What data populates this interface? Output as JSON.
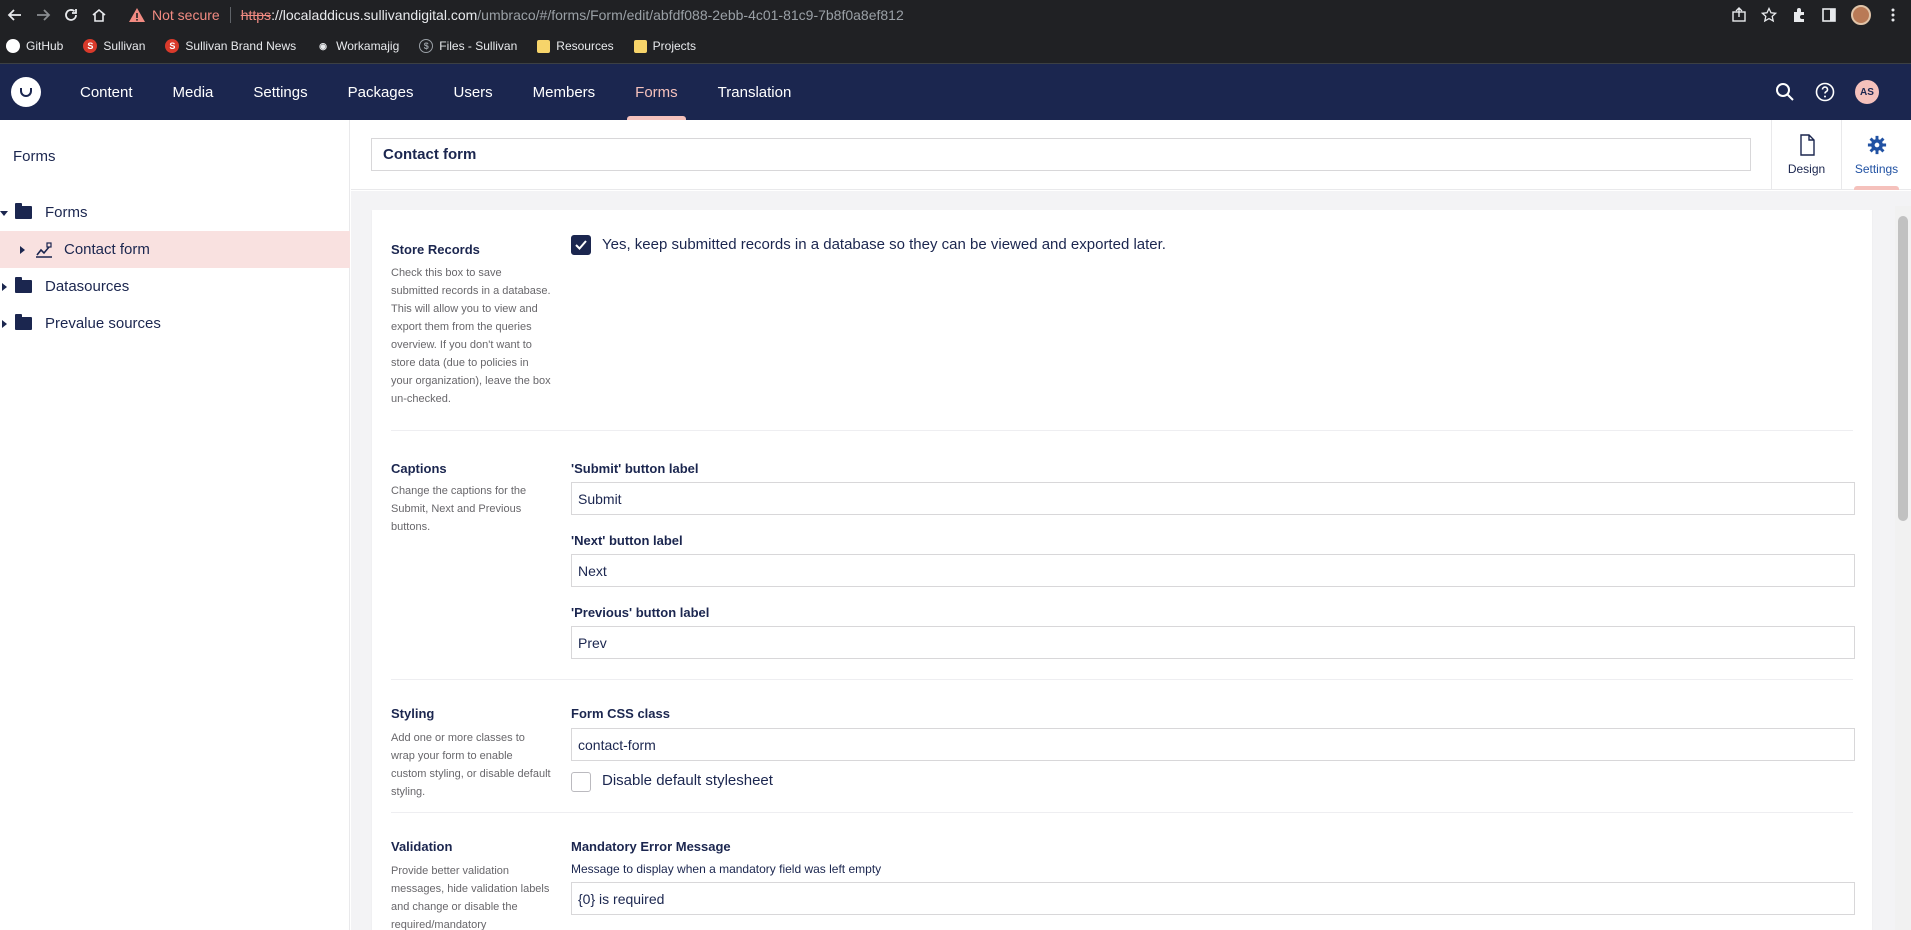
{
  "browser": {
    "security_label": "Not secure",
    "url_scheme": "https",
    "url_sep": "://",
    "url_host": "localaddicus.sullivandigital.com",
    "url_path": "/umbraco/#/forms/Form/edit/abfdf088-2ebb-4c01-81c9-7b8f0a8ef812"
  },
  "bookmarks": [
    {
      "label": "GitHub",
      "icon": "github-icon"
    },
    {
      "label": "Sullivan",
      "icon": "sullivan-icon"
    },
    {
      "label": "Sullivan Brand News",
      "icon": "sullivan-icon"
    },
    {
      "label": "Workamajig",
      "icon": "workamajig-icon"
    },
    {
      "label": "Files - Sullivan",
      "icon": "files-icon"
    },
    {
      "label": "Resources",
      "icon": "folder-icon"
    },
    {
      "label": "Projects",
      "icon": "folder-icon"
    }
  ],
  "topnav": {
    "sections": [
      "Content",
      "Media",
      "Settings",
      "Packages",
      "Users",
      "Members",
      "Forms",
      "Translation"
    ],
    "active_section": "Forms",
    "avatar_initials": "AS"
  },
  "sidebar": {
    "title": "Forms",
    "items": [
      {
        "label": "Forms"
      },
      {
        "label": "Contact form"
      },
      {
        "label": "Datasources"
      },
      {
        "label": "Prevalue sources"
      }
    ]
  },
  "editor": {
    "form_name": "Contact form",
    "apps": [
      {
        "label": "Design",
        "icon": "document-icon"
      },
      {
        "label": "Settings",
        "icon": "gear-icon"
      }
    ]
  },
  "settings": {
    "store_records": {
      "title": "Store Records",
      "description": "Check this box to save submitted records in a database. This will allow you to view and export them from the queries overview. If you don't want to store data (due to policies in your organization), leave the box un-checked.",
      "checkbox_label": "Yes, keep submitted records in a database so they can be viewed and exported later.",
      "checked": true
    },
    "captions": {
      "title": "Captions",
      "description": "Change the captions for the Submit, Next and Previous buttons.",
      "submit_label": "'Submit' button label",
      "submit_value": "Submit",
      "next_label": "'Next' button label",
      "next_value": "Next",
      "prev_label": "'Previous' button label",
      "prev_value": "Prev"
    },
    "styling": {
      "title": "Styling",
      "description": "Add one or more classes to wrap your form to enable custom styling, or disable default styling.",
      "css_label": "Form CSS class",
      "css_value": "contact-form",
      "disable_label": "Disable default stylesheet",
      "disable_checked": false
    },
    "validation": {
      "title": "Validation",
      "description": "Provide better validation messages, hide validation labels and change or disable the required/mandatory",
      "mandatory_label": "Mandatory Error Message",
      "mandatory_sub": "Message to display when a mandatory field was left empty",
      "mandatory_value": "{0} is required"
    }
  },
  "colors": {
    "nav_bg": "#1b264f",
    "accent": "#f5c1bc",
    "selected_row": "#f9e1e0"
  }
}
